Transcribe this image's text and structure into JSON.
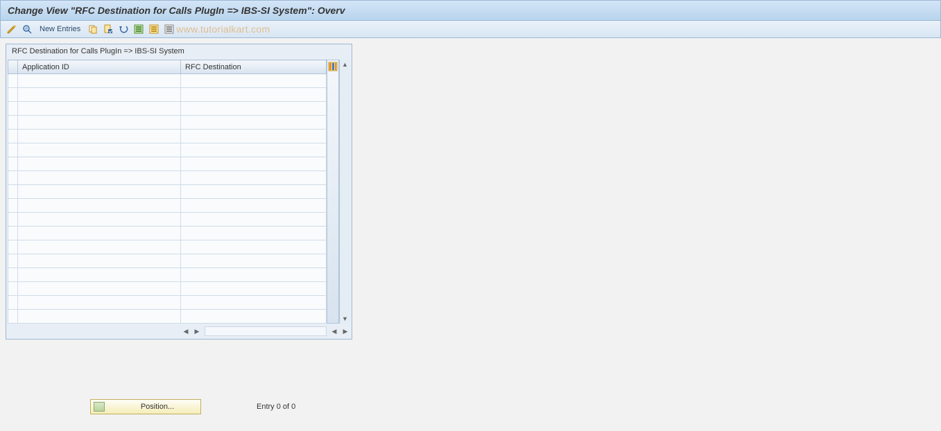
{
  "title": "Change View \"RFC Destination for Calls PlugIn => IBS-SI System\": Overv",
  "toolbar": {
    "new_entries_label": "New Entries",
    "icons": [
      {
        "name": "display-change-icon"
      },
      {
        "name": "other-view-icon"
      },
      {
        "name": "copy-icon"
      },
      {
        "name": "delete-icon"
      },
      {
        "name": "undo-icon"
      },
      {
        "name": "select-all-icon"
      },
      {
        "name": "select-block-icon"
      },
      {
        "name": "deselect-all-icon"
      }
    ]
  },
  "watermark": "www.tutorialkart.com",
  "grid": {
    "title": "RFC Destination for Calls PlugIn => IBS-SI System",
    "columns": {
      "application_id": "Application ID",
      "rfc_destination": "RFC Destination"
    },
    "rows": [
      {
        "app_id": "",
        "rfc_dest": ""
      },
      {
        "app_id": "",
        "rfc_dest": ""
      },
      {
        "app_id": "",
        "rfc_dest": ""
      },
      {
        "app_id": "",
        "rfc_dest": ""
      },
      {
        "app_id": "",
        "rfc_dest": ""
      },
      {
        "app_id": "",
        "rfc_dest": ""
      },
      {
        "app_id": "",
        "rfc_dest": ""
      },
      {
        "app_id": "",
        "rfc_dest": ""
      },
      {
        "app_id": "",
        "rfc_dest": ""
      },
      {
        "app_id": "",
        "rfc_dest": ""
      },
      {
        "app_id": "",
        "rfc_dest": ""
      },
      {
        "app_id": "",
        "rfc_dest": ""
      },
      {
        "app_id": "",
        "rfc_dest": ""
      },
      {
        "app_id": "",
        "rfc_dest": ""
      },
      {
        "app_id": "",
        "rfc_dest": ""
      },
      {
        "app_id": "",
        "rfc_dest": ""
      },
      {
        "app_id": "",
        "rfc_dest": ""
      },
      {
        "app_id": "",
        "rfc_dest": ""
      }
    ]
  },
  "footer": {
    "position_label": "Position...",
    "entry_status": "Entry 0 of 0"
  }
}
